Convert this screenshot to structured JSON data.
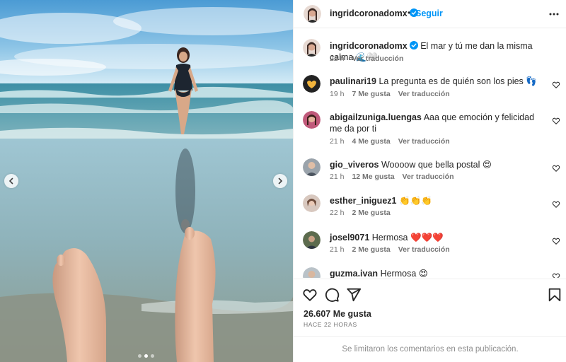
{
  "post": {
    "username": "ingridcoronadomx",
    "follow_label": "Seguir",
    "separator": "•",
    "caption": {
      "username": "ingridcoronadomx",
      "text": "El mar y tú me dan la misma calma 🌊🤍",
      "time": "22 h",
      "translate": "Ver traducción"
    },
    "carousel": {
      "total": 3,
      "active": 2
    }
  },
  "comments": [
    {
      "username": "paulinari19",
      "text": "La pregunta es de quién son los pies 👣",
      "time": "19 h",
      "likes": "7 Me gusta",
      "translate": "Ver traducción"
    },
    {
      "username": "abigailzuniga.luengas",
      "text": "Aaa que emoción y felicidad me da por ti",
      "time": "21 h",
      "likes": "4 Me gusta",
      "translate": "Ver traducción"
    },
    {
      "username": "gio_viveros",
      "text": "Woooow que bella postal 😍",
      "time": "21 h",
      "likes": "12 Me gusta",
      "translate": "Ver traducción"
    },
    {
      "username": "esther_iniguez1",
      "text": "👏👏👏",
      "time": "22 h",
      "likes": "2 Me gusta",
      "translate": ""
    },
    {
      "username": "josel9071",
      "text": "Hermosa ❤️❤️❤️",
      "time": "21 h",
      "likes": "2 Me gusta",
      "translate": "Ver traducción"
    },
    {
      "username": "guzma.ivan",
      "text": "Hermosa 😍",
      "time": "",
      "likes": "",
      "translate": ""
    }
  ],
  "stats": {
    "likes": "26.607 Me gusta",
    "time_ago": "HACE 22 HORAS"
  },
  "footer": {
    "text": "Se limitaron los comentarios en esta publicación."
  },
  "colors": {
    "accent": "#0095f6",
    "verified": "#0095f6",
    "muted": "#737373"
  },
  "icons": {
    "header_more": "more-horizontal-icon",
    "like": "heart-outline-icon",
    "comment": "comment-bubble-icon",
    "share": "paper-plane-icon",
    "save": "bookmark-icon"
  }
}
